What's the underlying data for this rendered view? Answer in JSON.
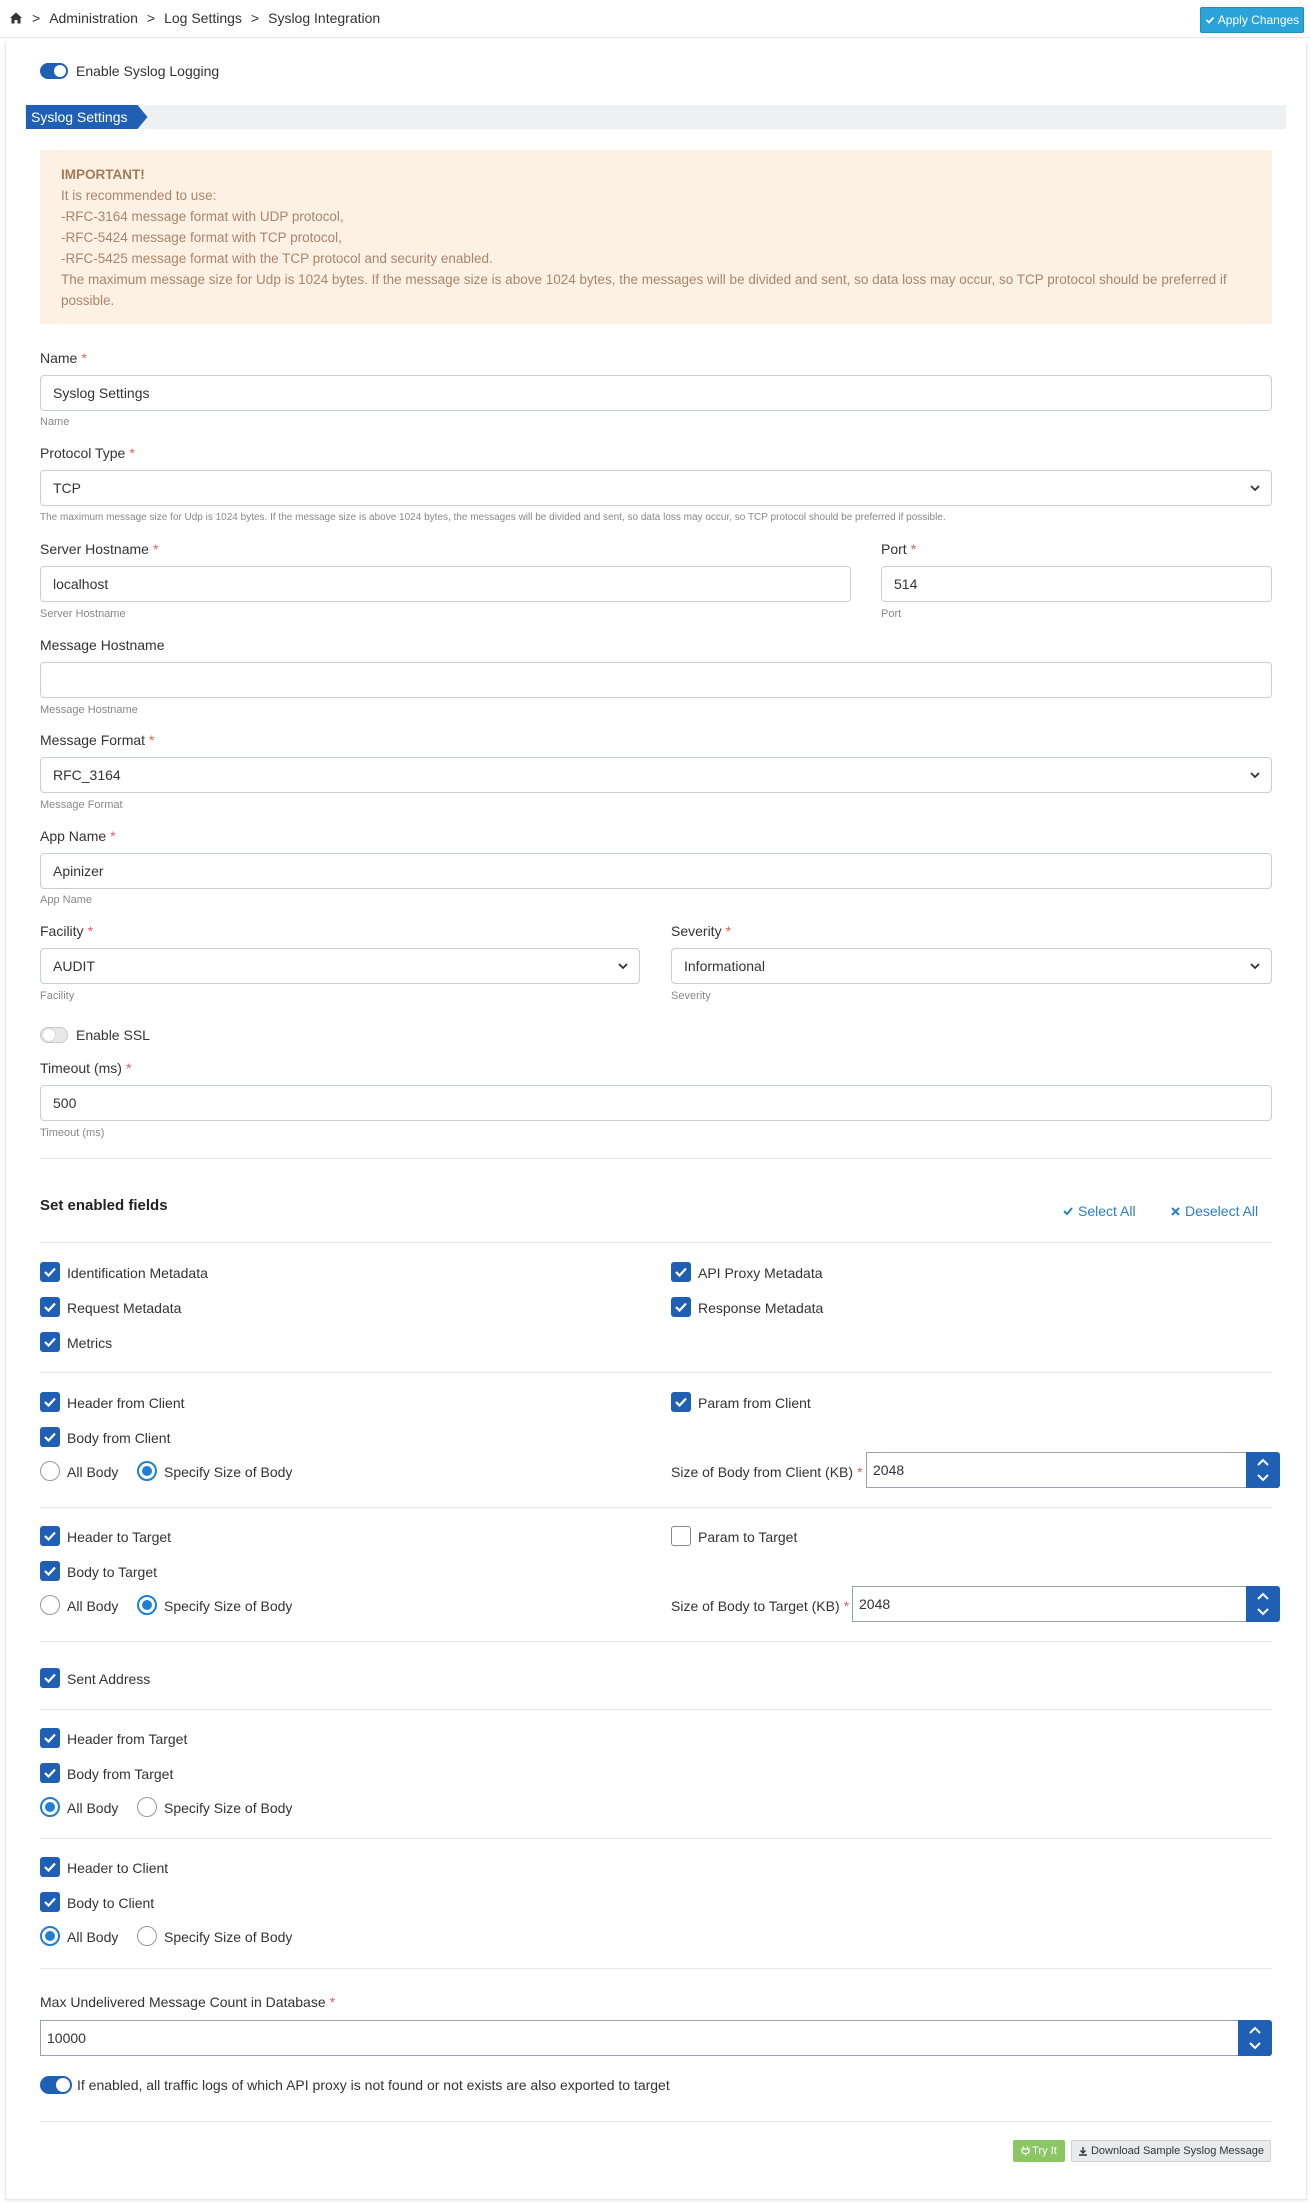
{
  "breadcrumb": {
    "items": [
      "Administration",
      "Log Settings",
      "Syslog Integration"
    ],
    "separator": ">"
  },
  "toolbar": {
    "apply_label": "Apply Changes"
  },
  "enable_syslog": {
    "label": "Enable Syslog Logging",
    "on": true
  },
  "tab": {
    "label": "Syslog Settings"
  },
  "alert": {
    "title": "IMPORTANT!",
    "lines": [
      "It is recommended to use:",
      "-RFC-3164 message format with UDP protocol,",
      "-RFC-5424 message format with TCP protocol,",
      "-RFC-5425 message format with the TCP protocol and security enabled.",
      "The maximum message size for Udp is 1024 bytes. If the message size is above 1024 bytes, the messages will be divided and sent, so data loss may occur, so TCP protocol should be preferred if possible."
    ]
  },
  "form": {
    "name": {
      "label": "Name",
      "value": "Syslog Settings",
      "help": "Name"
    },
    "protocol": {
      "label": "Protocol Type",
      "value": "TCP",
      "help": "The maximum message size for Udp is 1024 bytes. If the message size is above 1024 bytes, the messages will be divided and sent, so data loss may occur, so TCP protocol should be preferred if possible."
    },
    "server_hostname": {
      "label": "Server Hostname",
      "value": "localhost",
      "help": "Server Hostname"
    },
    "port": {
      "label": "Port",
      "value": "514",
      "help": "Port"
    },
    "message_hostname": {
      "label": "Message Hostname",
      "value": "",
      "help": "Message Hostname"
    },
    "message_format": {
      "label": "Message Format",
      "value": "RFC_3164",
      "help": "Message Format"
    },
    "app_name": {
      "label": "App Name",
      "value": "Apinizer",
      "help": "App Name"
    },
    "facility": {
      "label": "Facility",
      "value": "AUDIT",
      "help": "Facility"
    },
    "severity": {
      "label": "Severity",
      "value": "Informational",
      "help": "Severity"
    },
    "enable_ssl": {
      "label": "Enable SSL",
      "on": false
    },
    "timeout": {
      "label": "Timeout (ms)",
      "value": "500",
      "help": "Timeout (ms)"
    }
  },
  "fields": {
    "title": "Set enabled fields",
    "select_all": "Select All",
    "deselect_all": "Deselect All",
    "identification_metadata": "Identification Metadata",
    "api_proxy_metadata": "API Proxy Metadata",
    "request_metadata": "Request Metadata",
    "response_metadata": "Response Metadata",
    "metrics": "Metrics",
    "header_from_client": "Header from Client",
    "param_from_client": "Param from Client",
    "body_from_client": "Body from Client",
    "all_body": "All Body",
    "specify_size": "Specify Size of Body",
    "size_body_from_client": {
      "label": "Size of Body from Client (KB)",
      "value": "2048"
    },
    "header_to_target": "Header to Target",
    "param_to_target": "Param to Target",
    "body_to_target": "Body to Target",
    "size_body_to_target": {
      "label": "Size of Body to Target (KB)",
      "value": "2048"
    },
    "sent_address": "Sent Address",
    "header_from_target": "Header from Target",
    "body_from_target": "Body from Target",
    "header_to_client": "Header to Client",
    "body_to_client": "Body to Client"
  },
  "max_undelivered": {
    "label": "Max Undelivered Message Count in Database",
    "value": "10000"
  },
  "export_not_found": {
    "label": "If enabled, all traffic logs of which API proxy is not found or not exists are also exported to target",
    "on": true
  },
  "footer": {
    "try_label": "Try It",
    "download_label": "Download Sample Syslog Message"
  }
}
